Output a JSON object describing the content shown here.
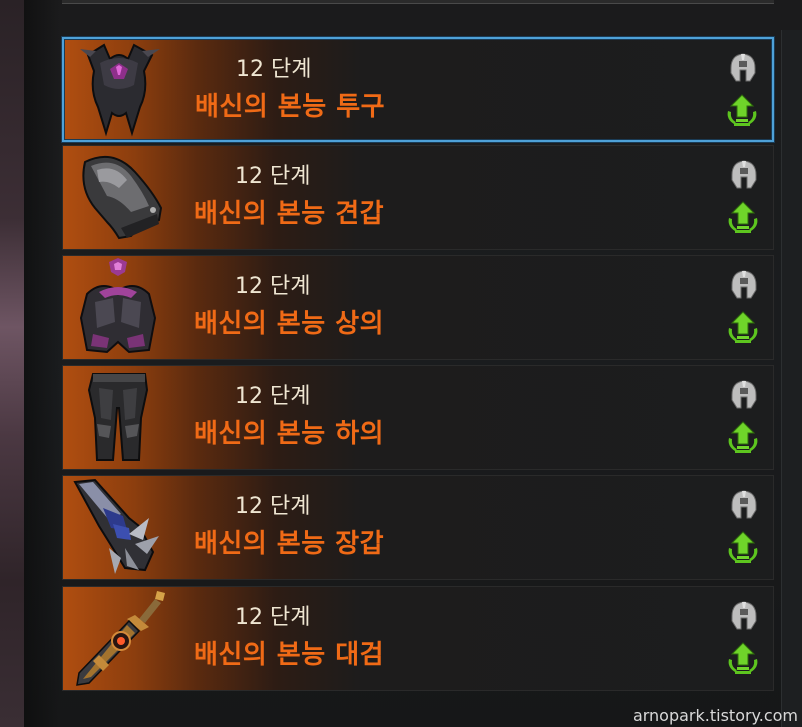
{
  "watermark": "arnopark.tistory.com",
  "colors": {
    "level_text": "#efe6d2",
    "name_text": "#f06a16",
    "selection_border": "#4ea1d8",
    "upgrade_green": "#5dc51f",
    "helmet_gray": "#bdbdbd"
  },
  "equipment_list": {
    "selected_index": 0,
    "items": [
      {
        "level": "12 단계",
        "name": "배신의 본능 투구",
        "icon": "helmet-item-icon"
      },
      {
        "level": "12 단계",
        "name": "배신의 본능 견갑",
        "icon": "shoulder-item-icon"
      },
      {
        "level": "12 단계",
        "name": "배신의 본능 상의",
        "icon": "chest-item-icon"
      },
      {
        "level": "12 단계",
        "name": "배신의 본능 하의",
        "icon": "pants-item-icon"
      },
      {
        "level": "12 단계",
        "name": "배신의 본능 장갑",
        "icon": "gloves-item-icon"
      },
      {
        "level": "12 단계",
        "name": "배신의 본능 대검",
        "icon": "greatsword-item-icon"
      }
    ]
  }
}
